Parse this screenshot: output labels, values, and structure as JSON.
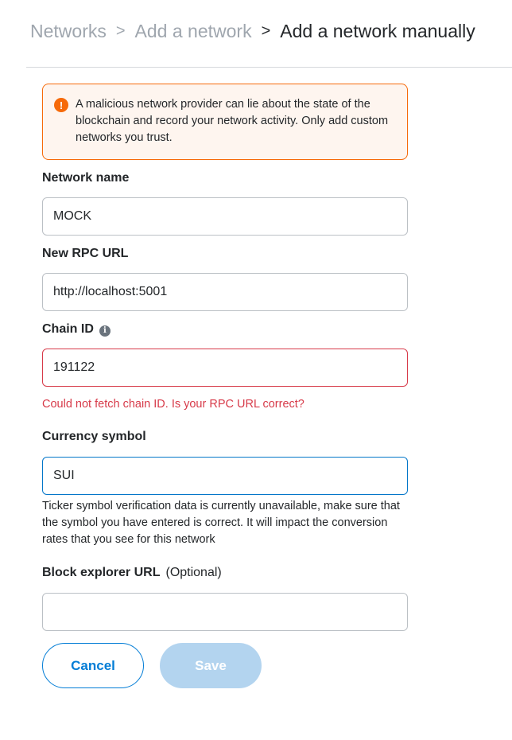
{
  "breadcrumb": {
    "items": [
      "Networks",
      "Add a network",
      "Add a network manually"
    ],
    "separator": ">"
  },
  "warning": {
    "icon": "exclamation-circle-icon",
    "text": "A malicious network provider can lie about the state of the blockchain and record your network activity. Only add custom networks you trust."
  },
  "fields": {
    "network_name": {
      "label": "Network name",
      "value": "MOCK"
    },
    "rpc_url": {
      "label": "New RPC URL",
      "value": "http://localhost:5001"
    },
    "chain_id": {
      "label": "Chain ID",
      "value": "191122",
      "error": "Could not fetch chain ID. Is your RPC URL correct?"
    },
    "currency_symbol": {
      "label": "Currency symbol",
      "value": "SUI",
      "help": "Ticker symbol verification data is currently unavailable, make sure that the symbol you have entered is correct. It will impact the conversion rates that you see for this network"
    },
    "block_explorer": {
      "label": "Block explorer URL",
      "optional": "(Optional)",
      "value": ""
    }
  },
  "buttons": {
    "cancel": "Cancel",
    "save": "Save"
  },
  "colors": {
    "primary": "#037dd6",
    "warning": "#f66a0a",
    "error": "#d73a49",
    "focus": "#0376c9",
    "disabled": "#b3d4ef"
  }
}
